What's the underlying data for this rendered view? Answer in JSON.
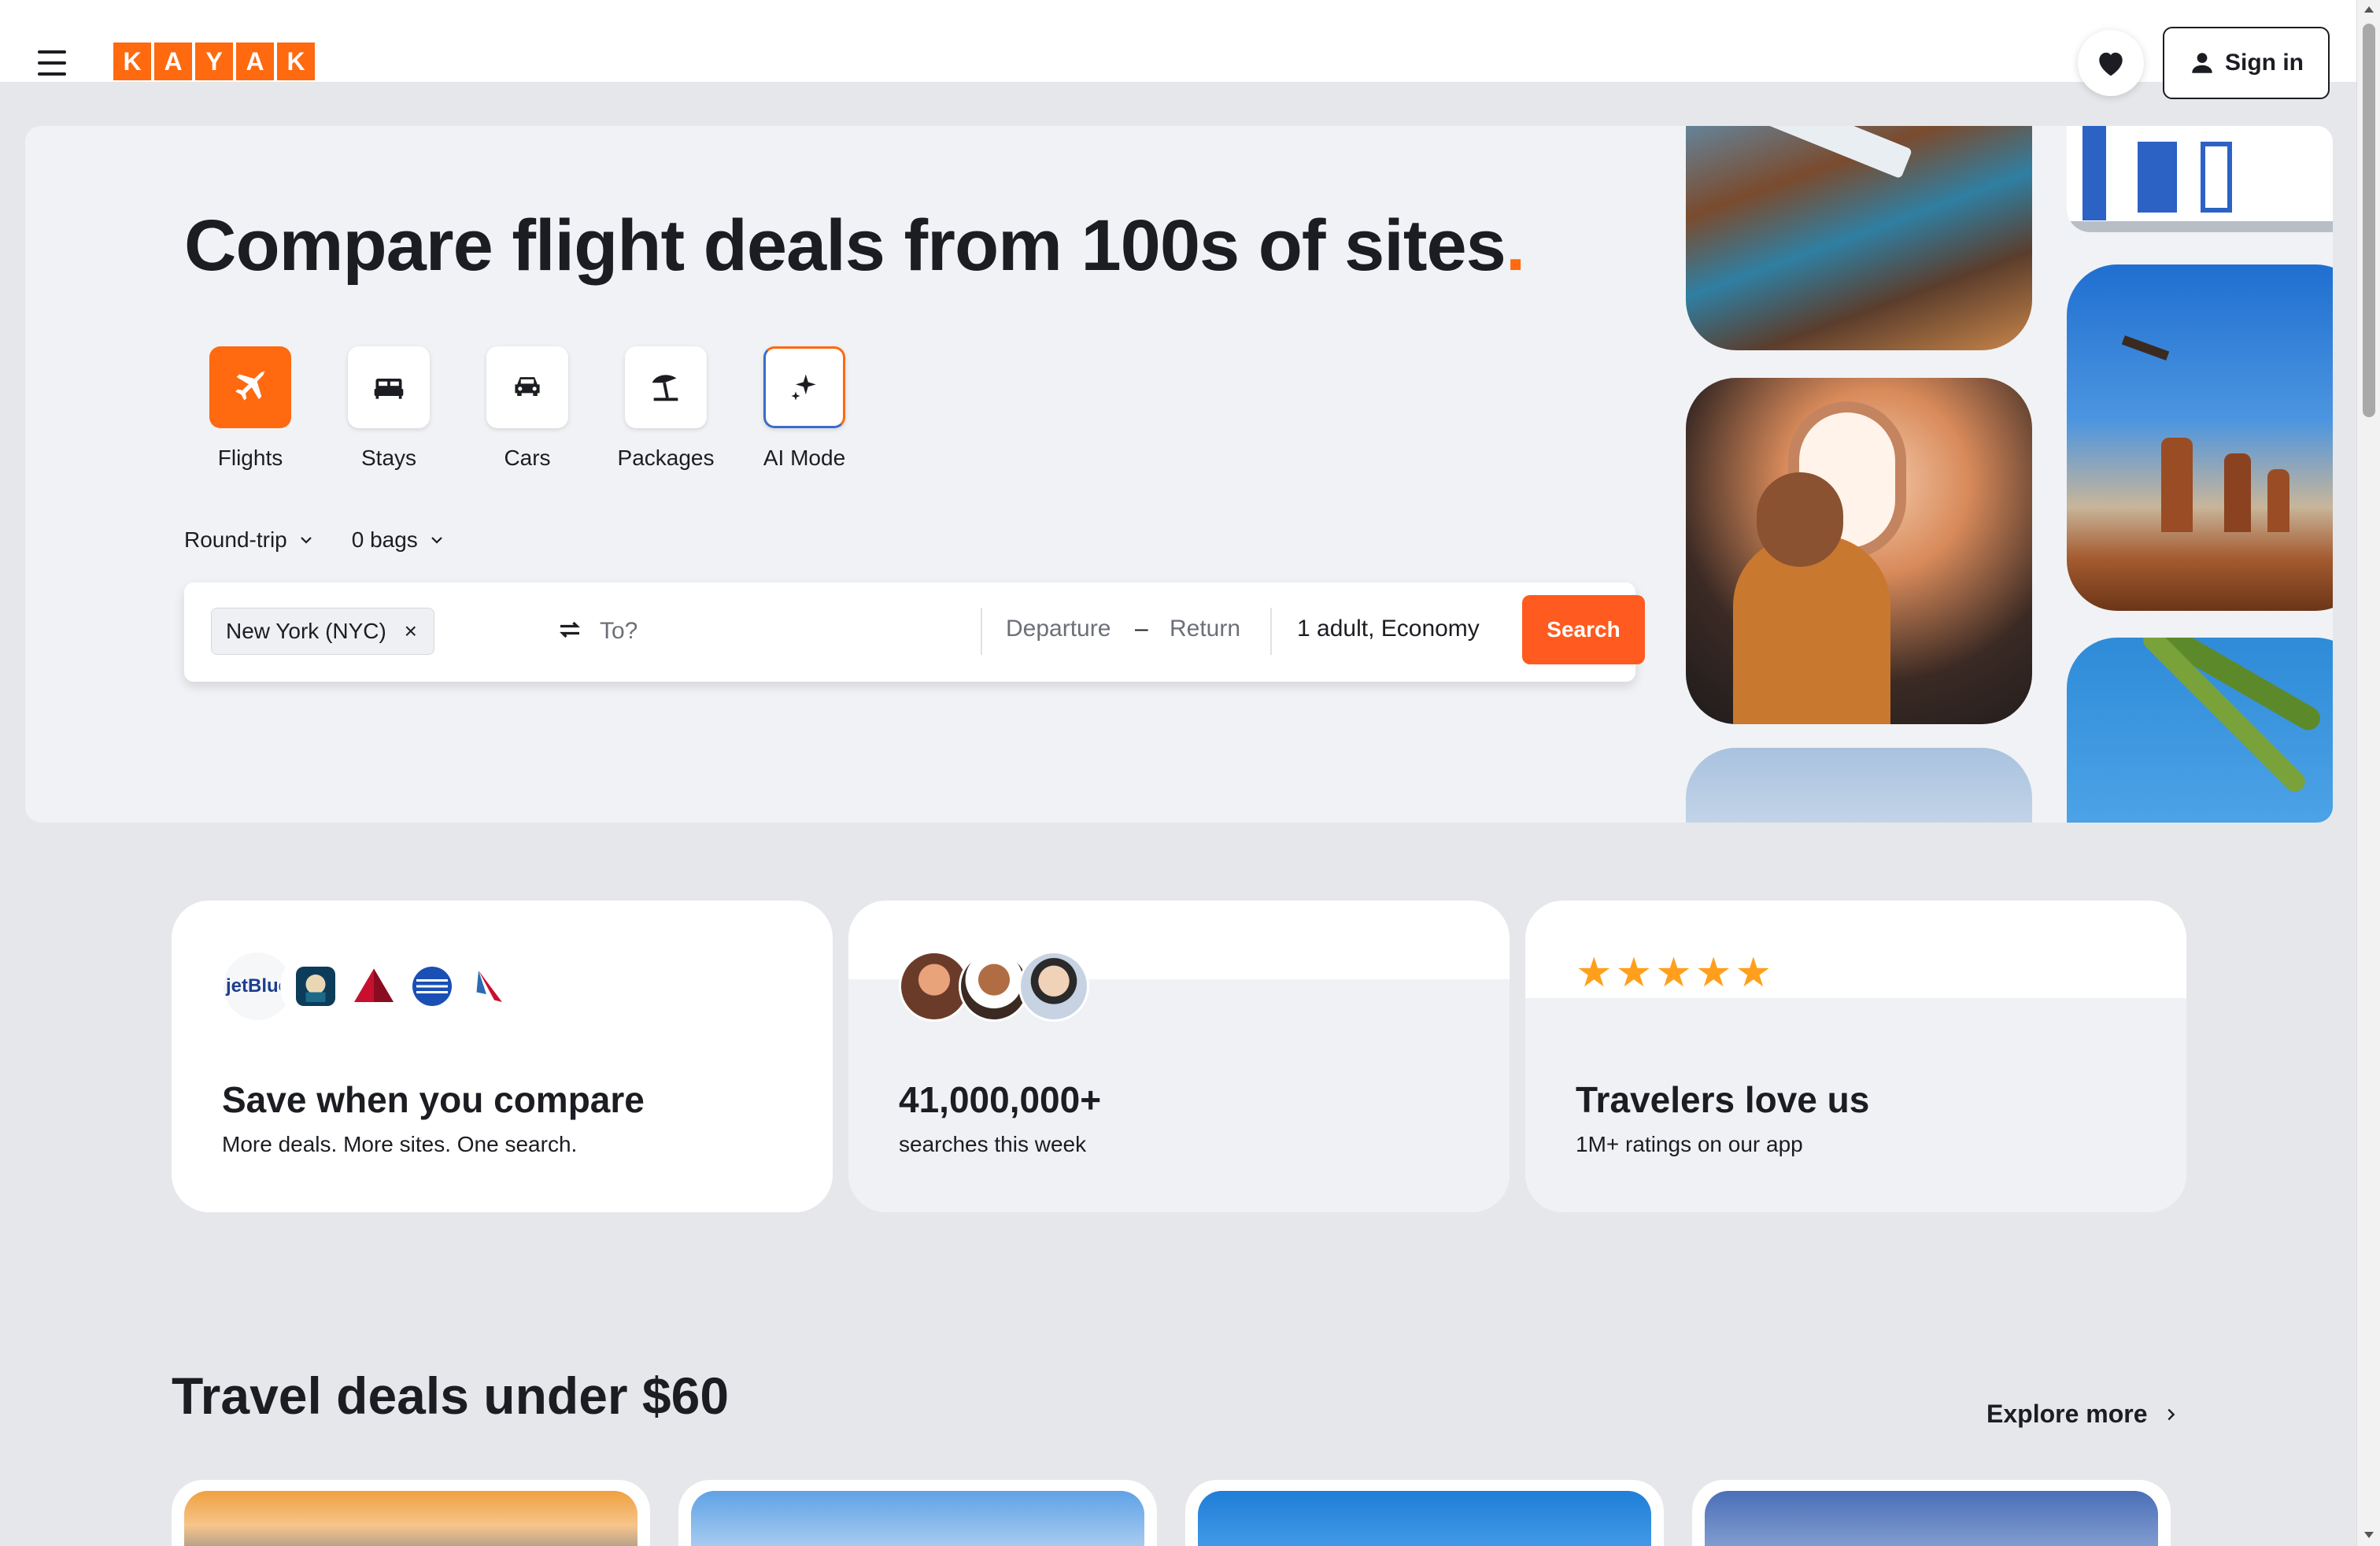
{
  "header": {
    "logo_letters": [
      "K",
      "A",
      "Y",
      "A",
      "K"
    ],
    "sign_in_label": "Sign in",
    "menu_icon": "hamburger-menu-icon",
    "favorites_icon": "heart-icon",
    "user_icon": "user-icon"
  },
  "hero": {
    "title": "Compare flight deals from 100s of sites",
    "title_dot": ".",
    "verticals": [
      {
        "label": "Flights",
        "icon": "plane-icon"
      },
      {
        "label": "Stays",
        "icon": "bed-icon"
      },
      {
        "label": "Cars",
        "icon": "car-icon"
      },
      {
        "label": "Packages",
        "icon": "beach-umbrella-icon"
      },
      {
        "label": "AI Mode",
        "icon": "sparkle-icon"
      }
    ],
    "trip_type": "Round-trip",
    "bags": "0 bags"
  },
  "search": {
    "origin": "New York (NYC)",
    "origin_clear": "×",
    "destination_placeholder": "To?",
    "departure_placeholder": "Departure",
    "date_separator": "–",
    "return_placeholder": "Return",
    "travelers": "1 adult, Economy",
    "search_label": "Search"
  },
  "stats": [
    {
      "title": "Save when you compare",
      "subtitle": "More deals. More sites. One search.",
      "airline_logos": [
        "jetBlue",
        "Alaska",
        "Delta",
        "United",
        "American"
      ]
    },
    {
      "title": "41,000,000+",
      "subtitle": "searches this week"
    },
    {
      "title": "Travelers love us",
      "subtitle": "1M+ ratings on our app",
      "stars": 5
    }
  ],
  "deals": {
    "title": "Travel deals under $60",
    "explore_label": "Explore more"
  },
  "colors": {
    "brand_orange": "#ff690f",
    "search_button": "#ff5a1f",
    "star": "#ff9f1c",
    "page_bg": "#e6e7ea"
  }
}
